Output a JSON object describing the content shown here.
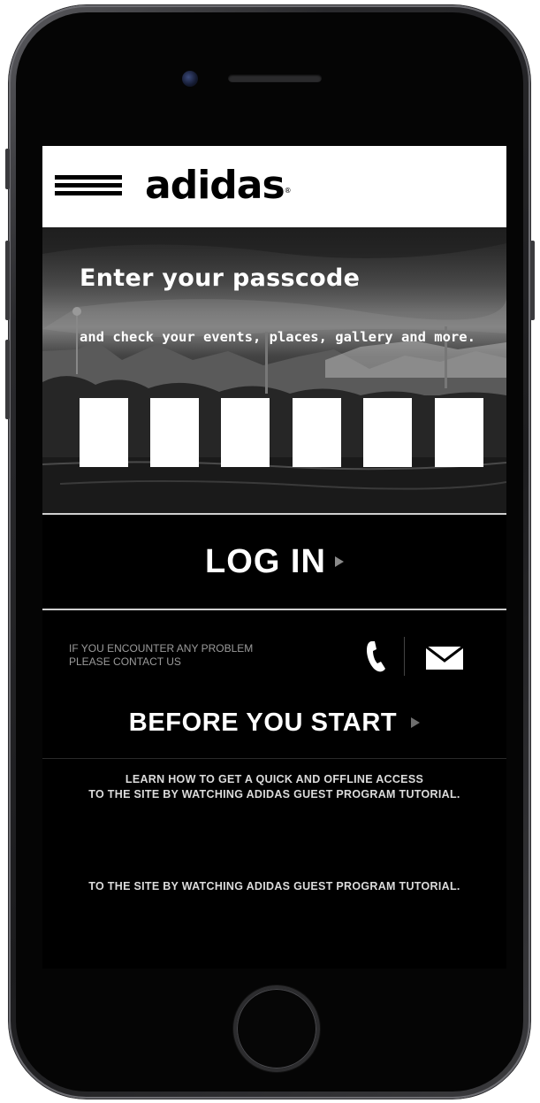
{
  "brand": {
    "logo_text": "adidas",
    "registered_mark": "®"
  },
  "hero": {
    "title": "Enter your passcode",
    "subtitle": "and check your events, places, gallery and more.",
    "pin_count": 6
  },
  "login": {
    "label": "LOG IN"
  },
  "contact": {
    "line1": "IF YOU ENCOUNTER ANY PROBLEM",
    "line2": "PLEASE CONTACT US",
    "phone_icon": "phone-icon",
    "mail_icon": "mail-icon"
  },
  "before_start": {
    "label": "BEFORE YOU START"
  },
  "tutorial": {
    "line1": "LEARN HOW TO GET A QUICK AND OFFLINE ACCESS",
    "line2": "TO THE SITE BY WATCHING ADIDAS GUEST PROGRAM TUTORIAL.",
    "repeat_line": "TO THE SITE BY WATCHING ADIDAS GUEST PROGRAM TUTORIAL."
  },
  "colors": {
    "background": "#000000",
    "text": "#ffffff",
    "muted_text": "#9a9a9a",
    "arrow": "#8a8a8a",
    "divider": "#cfcfcf"
  }
}
